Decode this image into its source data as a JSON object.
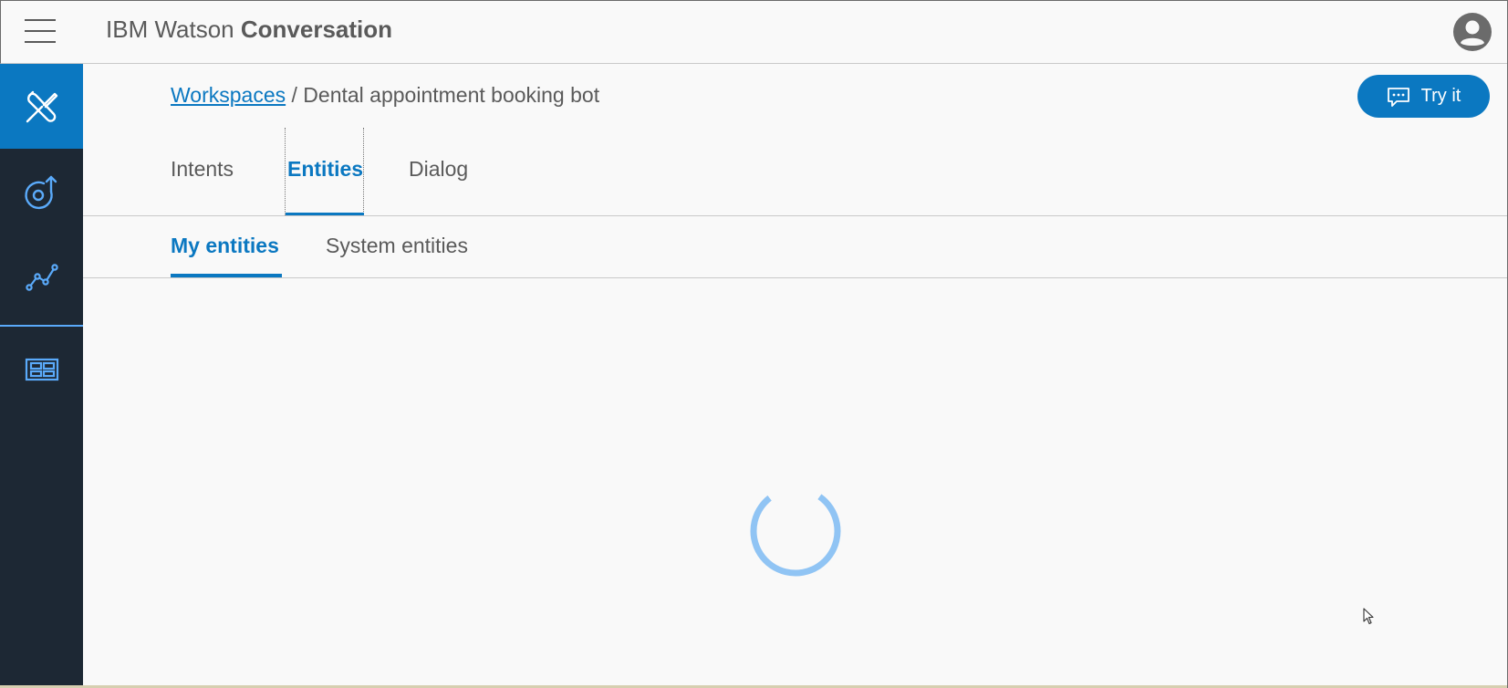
{
  "app": {
    "brand_prefix": "IBM Watson",
    "brand_product": "Conversation"
  },
  "icons": {
    "menu": "hamburger-menu-icon",
    "user": "user-avatar-icon",
    "build": "tools-wrench-screwdriver-icon",
    "improve": "circle-arrow-icon",
    "analytics": "line-graph-icon",
    "deploy": "panels-grid-icon",
    "chat": "chat-bubble-icon",
    "loading": "loading-spinner"
  },
  "breadcrumb": {
    "link": "Workspaces",
    "separator": "/",
    "current": "Dental appointment booking bot"
  },
  "try_it": {
    "label": "Try it"
  },
  "tabs": [
    {
      "label": "Intents",
      "active": false
    },
    {
      "label": "Entities",
      "active": true
    },
    {
      "label": "Dialog",
      "active": false
    }
  ],
  "subtabs": [
    {
      "label": "My entities",
      "active": true
    },
    {
      "label": "System entities",
      "active": false
    }
  ],
  "colors": {
    "accent": "#0b78c1",
    "sidebar": "#1d2834",
    "spinner": "#90c4f4",
    "text": "#5a5a5a"
  }
}
